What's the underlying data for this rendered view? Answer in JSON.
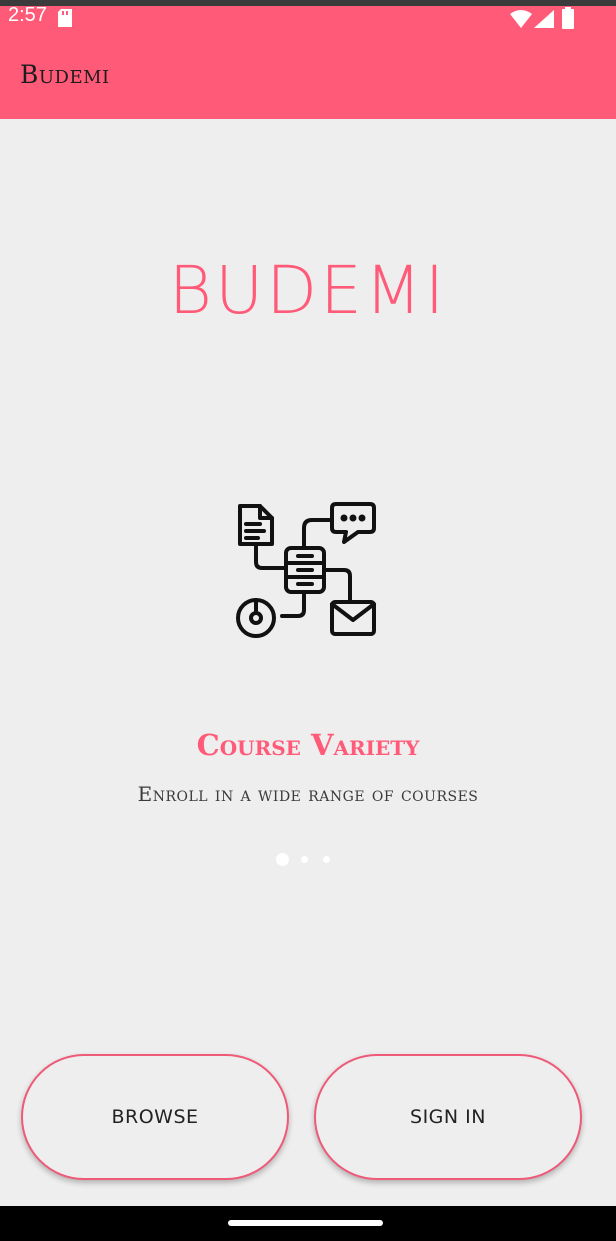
{
  "status_bar": {
    "time": "2:57",
    "icons": [
      "sd-card-icon",
      "wifi-icon",
      "signal-icon",
      "battery-icon"
    ]
  },
  "app_bar": {
    "title": "Budemi",
    "color": "#ff5a78"
  },
  "brand": {
    "text": "BUDEMI"
  },
  "onboarding": {
    "slide_title": "Course Variety",
    "slide_description": "Enroll in a wide range of courses",
    "illustration_icon": "network-diagram-icon",
    "page_indicator": {
      "total": 3,
      "current": 1
    }
  },
  "actions": {
    "browse_label": "BROWSE",
    "sign_in_label": "SIGN IN"
  },
  "colors": {
    "accent": "#ff5a78",
    "background": "#eeeeee"
  }
}
